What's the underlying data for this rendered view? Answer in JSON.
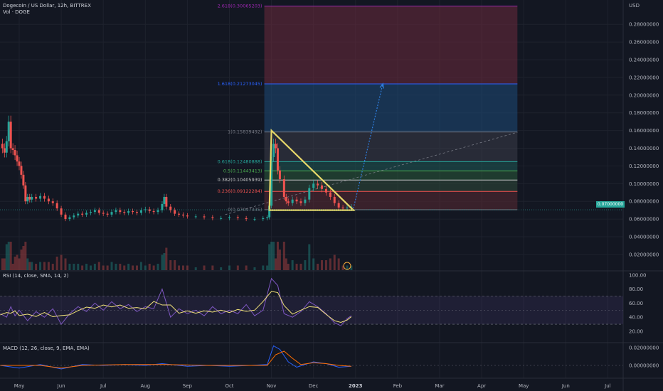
{
  "header": {
    "symbol_title": "Dogecoin / US Dollar, 12h, BITTREX",
    "volume_label": "Vol · DOGE",
    "currency": "USD",
    "price_badge": "0.07000000"
  },
  "colors": {
    "background": "#131722",
    "up": "#26a69a",
    "down": "#ef5350",
    "triangle": "#e7d86a",
    "projection": "#2f7fe0",
    "rsi_line": "#7e57c2",
    "rsi_ma": "#f2e27a",
    "macd_line": "#2962ff",
    "signal_line": "#ff6d00"
  },
  "indicators": {
    "rsi_label": "RSI (14, close, SMA, 14, 2)",
    "macd_label": "MACD (12, 26, close, 9, EMA, EMA)"
  },
  "fib_levels": [
    {
      "label": "2.618(0.30065203)",
      "value": 0.30065203,
      "color": "#9c27b0"
    },
    {
      "label": "1.618(0.21273045)",
      "value": 0.21273045,
      "color": "#2962ff"
    },
    {
      "label": "1(0.15839492)",
      "value": 0.15839492,
      "color": "#787b86"
    },
    {
      "label": "0.618(0.12480888)",
      "value": 0.12480888,
      "color": "#26a69a"
    },
    {
      "label": "0.5(0.11443413)",
      "value": 0.11443413,
      "color": "#4caf50"
    },
    {
      "label": "0.382(0.10405939)",
      "value": 0.10405939,
      "color": "#c8c8c8"
    },
    {
      "label": "0.236(0.09122284)",
      "value": 0.09122284,
      "color": "#ef5350"
    },
    {
      "label": "0(0.07047335)",
      "value": 0.07047335,
      "color": "#787b86"
    }
  ],
  "price_axis": {
    "ticks": [
      "0.28000000",
      "0.26000000",
      "0.24000000",
      "0.22000000",
      "0.20000000",
      "0.18000000",
      "0.16000000",
      "0.14000000",
      "0.12000000",
      "0.10000000",
      "0.08000000",
      "0.06000000",
      "0.04000000",
      "0.02000000"
    ],
    "values": [
      0.28,
      0.26,
      0.24,
      0.22,
      0.2,
      0.18,
      0.16,
      0.14,
      0.12,
      0.1,
      0.08,
      0.06,
      0.04,
      0.02
    ]
  },
  "rsi_axis": {
    "ticks": [
      "100.00",
      "80.00",
      "60.00",
      "40.00",
      "20.00"
    ],
    "values": [
      100,
      80,
      60,
      40,
      20
    ]
  },
  "macd_axis": {
    "ticks": [
      "0.02000000",
      "0.00000000"
    ],
    "values": [
      0.02,
      0.0
    ]
  },
  "time_axis": {
    "labels": [
      "May",
      "Jun",
      "Jul",
      "Aug",
      "Sep",
      "Oct",
      "Nov",
      "Dec",
      "2023",
      "Feb",
      "Mar",
      "Apr",
      "May",
      "Jun",
      "Jul"
    ],
    "months": [
      0,
      1,
      2,
      3,
      4,
      5,
      6,
      7,
      8,
      9,
      10,
      11,
      12,
      13,
      14
    ]
  },
  "chart_data": {
    "type": "candlestick",
    "title": "Dogecoin / US Dollar, 12h, BITTREX",
    "x_axis": "time (months, May 2022 = 0)",
    "y_axis": "USD",
    "ylim": [
      0.0,
      0.3
    ],
    "price_path": [
      [
        -0.45,
        0.145
      ],
      [
        -0.4,
        0.14
      ],
      [
        -0.35,
        0.135
      ],
      [
        -0.3,
        0.148
      ],
      [
        -0.25,
        0.17
      ],
      [
        -0.2,
        0.14
      ],
      [
        -0.15,
        0.138
      ],
      [
        -0.1,
        0.132
      ],
      [
        -0.05,
        0.125
      ],
      [
        0.0,
        0.12
      ],
      [
        0.05,
        0.11
      ],
      [
        0.1,
        0.098
      ],
      [
        0.15,
        0.08
      ],
      [
        0.2,
        0.085
      ],
      [
        0.25,
        0.082
      ],
      [
        0.3,
        0.085
      ],
      [
        0.4,
        0.083
      ],
      [
        0.5,
        0.086
      ],
      [
        0.6,
        0.083
      ],
      [
        0.7,
        0.08
      ],
      [
        0.8,
        0.078
      ],
      [
        0.9,
        0.072
      ],
      [
        1.0,
        0.065
      ],
      [
        1.1,
        0.06
      ],
      [
        1.2,
        0.062
      ],
      [
        1.3,
        0.064
      ],
      [
        1.4,
        0.066
      ],
      [
        1.5,
        0.065
      ],
      [
        1.6,
        0.067
      ],
      [
        1.7,
        0.068
      ],
      [
        1.8,
        0.07
      ],
      [
        1.9,
        0.067
      ],
      [
        2.0,
        0.066
      ],
      [
        2.1,
        0.065
      ],
      [
        2.2,
        0.068
      ],
      [
        2.3,
        0.07
      ],
      [
        2.4,
        0.068
      ],
      [
        2.5,
        0.067
      ],
      [
        2.6,
        0.069
      ],
      [
        2.7,
        0.068
      ],
      [
        2.8,
        0.067
      ],
      [
        2.9,
        0.07
      ],
      [
        3.0,
        0.071
      ],
      [
        3.1,
        0.069
      ],
      [
        3.2,
        0.068
      ],
      [
        3.3,
        0.07
      ],
      [
        3.4,
        0.077
      ],
      [
        3.45,
        0.085
      ],
      [
        3.5,
        0.074
      ],
      [
        3.6,
        0.07
      ],
      [
        3.7,
        0.066
      ],
      [
        3.8,
        0.065
      ],
      [
        3.9,
        0.064
      ],
      [
        4.0,
        0.063
      ],
      [
        4.2,
        0.063
      ],
      [
        4.4,
        0.062
      ],
      [
        4.6,
        0.061
      ],
      [
        4.8,
        0.061
      ],
      [
        5.0,
        0.062
      ],
      [
        5.2,
        0.061
      ],
      [
        5.4,
        0.06
      ],
      [
        5.6,
        0.06
      ],
      [
        5.8,
        0.061
      ],
      [
        5.9,
        0.062
      ],
      [
        5.95,
        0.075
      ],
      [
        6.0,
        0.13
      ],
      [
        6.05,
        0.145
      ],
      [
        6.1,
        0.14
      ],
      [
        6.15,
        0.115
      ],
      [
        6.2,
        0.105
      ],
      [
        6.3,
        0.085
      ],
      [
        6.35,
        0.08
      ],
      [
        6.4,
        0.078
      ],
      [
        6.5,
        0.082
      ],
      [
        6.6,
        0.08
      ],
      [
        6.7,
        0.078
      ],
      [
        6.8,
        0.082
      ],
      [
        6.9,
        0.095
      ],
      [
        7.0,
        0.1
      ],
      [
        7.1,
        0.098
      ],
      [
        7.2,
        0.094
      ],
      [
        7.3,
        0.09
      ],
      [
        7.4,
        0.085
      ],
      [
        7.5,
        0.078
      ],
      [
        7.6,
        0.073
      ],
      [
        7.7,
        0.072
      ],
      [
        7.8,
        0.073
      ],
      [
        7.9,
        0.074
      ]
    ],
    "rsi_path": [
      [
        -0.45,
        45
      ],
      [
        -0.3,
        40
      ],
      [
        -0.2,
        55
      ],
      [
        -0.1,
        42
      ],
      [
        0.0,
        50
      ],
      [
        0.2,
        35
      ],
      [
        0.4,
        48
      ],
      [
        0.6,
        40
      ],
      [
        0.8,
        52
      ],
      [
        1.0,
        30
      ],
      [
        1.2,
        45
      ],
      [
        1.4,
        55
      ],
      [
        1.6,
        48
      ],
      [
        1.8,
        60
      ],
      [
        2.0,
        50
      ],
      [
        2.2,
        62
      ],
      [
        2.4,
        52
      ],
      [
        2.6,
        58
      ],
      [
        2.8,
        48
      ],
      [
        3.0,
        55
      ],
      [
        3.2,
        52
      ],
      [
        3.4,
        80
      ],
      [
        3.6,
        40
      ],
      [
        3.8,
        52
      ],
      [
        4.0,
        45
      ],
      [
        4.2,
        50
      ],
      [
        4.4,
        42
      ],
      [
        4.6,
        55
      ],
      [
        4.8,
        45
      ],
      [
        5.0,
        50
      ],
      [
        5.2,
        45
      ],
      [
        5.4,
        58
      ],
      [
        5.6,
        42
      ],
      [
        5.8,
        50
      ],
      [
        6.0,
        95
      ],
      [
        6.15,
        85
      ],
      [
        6.3,
        45
      ],
      [
        6.5,
        40
      ],
      [
        6.7,
        48
      ],
      [
        6.9,
        62
      ],
      [
        7.1,
        55
      ],
      [
        7.3,
        45
      ],
      [
        7.5,
        32
      ],
      [
        7.65,
        28
      ],
      [
        7.8,
        38
      ],
      [
        7.9,
        42
      ]
    ],
    "rsi_band": [
      30,
      70
    ],
    "macd_path": [
      [
        -0.45,
        0.0
      ],
      [
        0.0,
        -0.003
      ],
      [
        0.5,
        0.001
      ],
      [
        1.0,
        -0.004
      ],
      [
        1.5,
        0.001
      ],
      [
        2.0,
        0.0
      ],
      [
        2.5,
        0.001
      ],
      [
        3.0,
        0.0
      ],
      [
        3.4,
        0.002
      ],
      [
        4.0,
        -0.001
      ],
      [
        4.5,
        0.0
      ],
      [
        5.0,
        -0.001
      ],
      [
        5.5,
        0.0
      ],
      [
        5.9,
        0.001
      ],
      [
        6.05,
        0.022
      ],
      [
        6.2,
        0.018
      ],
      [
        6.4,
        0.004
      ],
      [
        6.6,
        -0.002
      ],
      [
        7.0,
        0.004
      ],
      [
        7.3,
        0.002
      ],
      [
        7.6,
        -0.002
      ],
      [
        7.9,
        -0.001
      ]
    ],
    "signal_path": [
      [
        -0.45,
        0.0
      ],
      [
        0.5,
        0.0
      ],
      [
        1.0,
        -0.003
      ],
      [
        1.5,
        0.0
      ],
      [
        2.5,
        0.001
      ],
      [
        3.5,
        0.001
      ],
      [
        4.5,
        0.0
      ],
      [
        5.5,
        0.0
      ],
      [
        5.9,
        0.0
      ],
      [
        6.1,
        0.012
      ],
      [
        6.3,
        0.016
      ],
      [
        6.5,
        0.008
      ],
      [
        6.7,
        0.001
      ],
      [
        7.0,
        0.003
      ],
      [
        7.3,
        0.002
      ],
      [
        7.6,
        0.0
      ],
      [
        7.9,
        -0.001
      ]
    ],
    "triangle": {
      "top": [
        6.0,
        0.16
      ],
      "bottom_left": [
        5.95,
        0.07
      ],
      "bottom_right": [
        7.95,
        0.07
      ]
    },
    "projection": {
      "from": [
        7.95,
        0.072
      ],
      "to": [
        8.65,
        0.213
      ]
    },
    "fib_range": [
      5.83,
      11.85
    ]
  }
}
